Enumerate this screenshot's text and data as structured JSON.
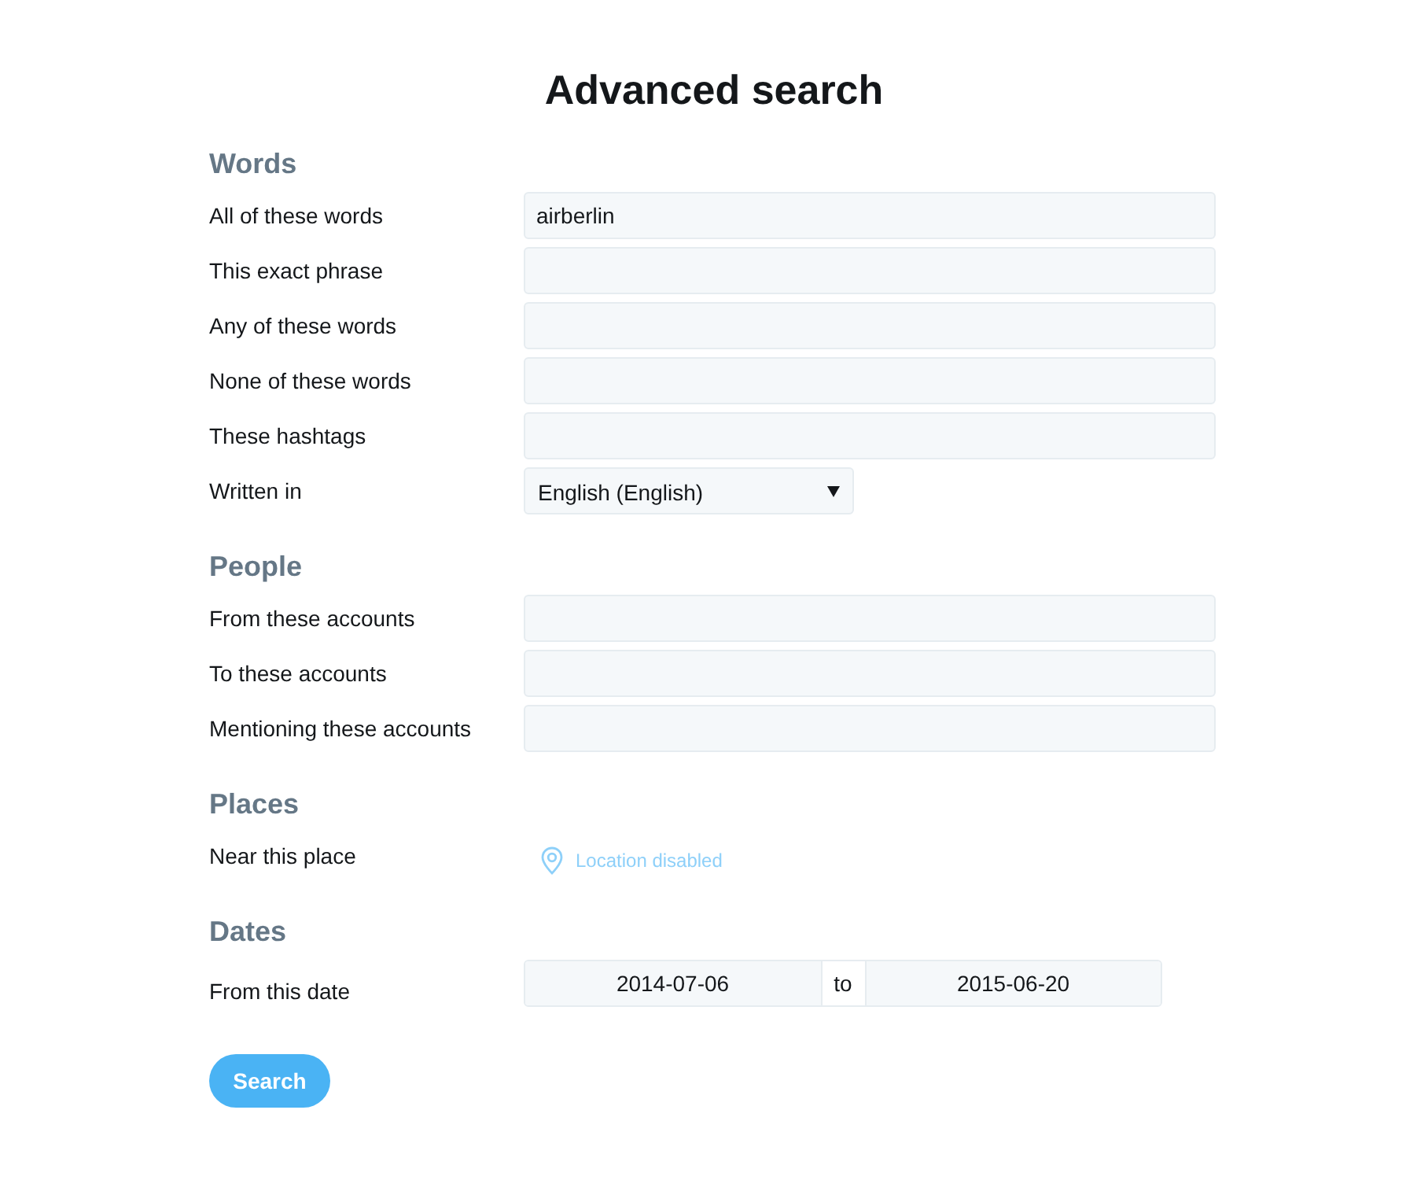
{
  "title": "Advanced search",
  "sections": [
    {
      "heading": "Words",
      "rows": [
        {
          "kind": "text",
          "label": "All of these words",
          "value": "airberlin"
        },
        {
          "kind": "text",
          "label": "This exact phrase"
        },
        {
          "kind": "text",
          "label": "Any of these words"
        },
        {
          "kind": "text",
          "label": "None of these words"
        },
        {
          "kind": "text",
          "label": "These hashtags"
        },
        {
          "kind": "select",
          "label": "Written in",
          "value": "English (English)"
        }
      ]
    },
    {
      "heading": "People",
      "rows": [
        {
          "kind": "text",
          "label": "From these accounts"
        },
        {
          "kind": "text",
          "label": "To these accounts"
        },
        {
          "kind": "text",
          "label": "Mentioning these accounts"
        }
      ]
    },
    {
      "heading": "Places",
      "rows": [
        {
          "kind": "location",
          "label": "Near this place",
          "status": "Location disabled",
          "disabled": true
        }
      ]
    },
    {
      "heading": "Dates",
      "rows": [
        {
          "kind": "daterange",
          "label": "From this date",
          "from": "2014-07-06",
          "separator": "to",
          "until": "2015-06-20"
        }
      ]
    }
  ],
  "search_button": {
    "label": "Search"
  }
}
